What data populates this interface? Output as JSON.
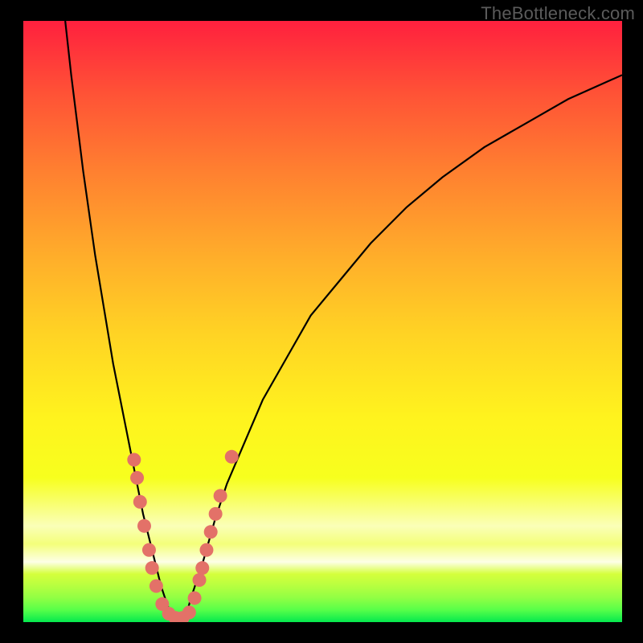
{
  "watermark": "TheBottleneck.com",
  "colors": {
    "frame": "#000000",
    "curve_stroke": "#000000",
    "marker_fill": "#e37168",
    "marker_stroke": "#d95b52"
  },
  "chart_data": {
    "type": "line",
    "title": "",
    "xlabel": "",
    "ylabel": "",
    "xlim": [
      0,
      100
    ],
    "ylim": [
      0,
      100
    ],
    "series": [
      {
        "name": "left-branch",
        "x": [
          7,
          8,
          9,
          10,
          11,
          12,
          13,
          14,
          15,
          16,
          17,
          18,
          19,
          20,
          21,
          22,
          23,
          24,
          25
        ],
        "y": [
          100,
          91,
          83,
          75,
          68,
          61,
          55,
          49,
          43,
          38,
          33,
          28,
          23,
          18,
          14,
          10,
          6,
          3,
          0.5
        ]
      },
      {
        "name": "right-branch",
        "x": [
          27,
          28,
          30,
          32,
          34,
          37,
          40,
          44,
          48,
          53,
          58,
          64,
          70,
          77,
          84,
          91,
          100
        ],
        "y": [
          0.5,
          4,
          10,
          17,
          23,
          30,
          37,
          44,
          51,
          57,
          63,
          69,
          74,
          79,
          83,
          87,
          91
        ]
      }
    ],
    "markers": {
      "name": "highlight-points",
      "points": [
        {
          "x": 18.5,
          "y": 27
        },
        {
          "x": 19.0,
          "y": 24
        },
        {
          "x": 19.5,
          "y": 20
        },
        {
          "x": 20.2,
          "y": 16
        },
        {
          "x": 21.0,
          "y": 12
        },
        {
          "x": 21.5,
          "y": 9
        },
        {
          "x": 22.2,
          "y": 6
        },
        {
          "x": 23.2,
          "y": 3
        },
        {
          "x": 24.3,
          "y": 1.4
        },
        {
          "x": 25.4,
          "y": 0.7
        },
        {
          "x": 26.6,
          "y": 0.7
        },
        {
          "x": 27.7,
          "y": 1.6
        },
        {
          "x": 28.6,
          "y": 4
        },
        {
          "x": 29.4,
          "y": 7
        },
        {
          "x": 29.9,
          "y": 9
        },
        {
          "x": 30.6,
          "y": 12
        },
        {
          "x": 31.3,
          "y": 15
        },
        {
          "x": 32.1,
          "y": 18
        },
        {
          "x": 32.9,
          "y": 21
        },
        {
          "x": 34.8,
          "y": 27.5
        }
      ]
    }
  }
}
